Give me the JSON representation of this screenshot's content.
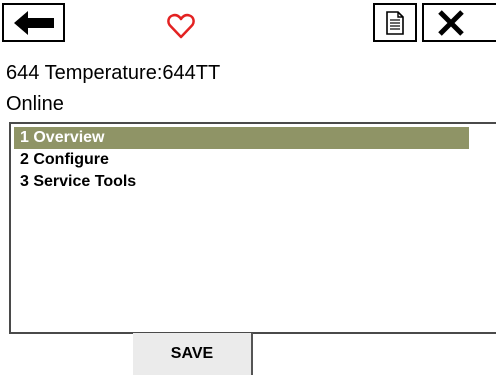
{
  "toolbar": {
    "back_icon": "arrow-left-icon",
    "favorite_icon": "heart-outline-icon",
    "document_icon": "document-icon",
    "close_icon": "close-x-icon",
    "favorite_color": "#e32222"
  },
  "header": {
    "device_title": "644 Temperature:644TT",
    "status": "Online"
  },
  "menu": {
    "items": [
      {
        "label": "1 Overview",
        "selected": true
      },
      {
        "label": "2 Configure",
        "selected": false
      },
      {
        "label": "3 Service Tools",
        "selected": false
      }
    ],
    "selected_color": "#8f9466"
  },
  "footer": {
    "save_label": "SAVE"
  }
}
